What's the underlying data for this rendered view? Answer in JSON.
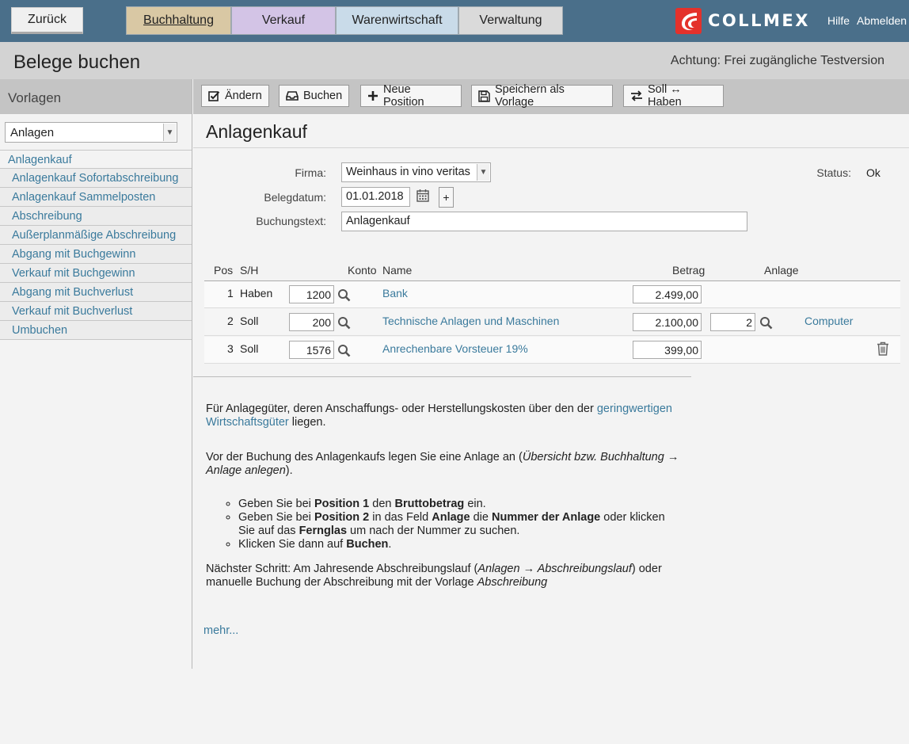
{
  "nav": {
    "back": "Zurück",
    "tabs": [
      "Buchhaltung",
      "Verkauf",
      "Warenwirtschaft",
      "Verwaltung"
    ],
    "logo": "COLLMEX",
    "help": "Hilfe",
    "logout": "Abmelden"
  },
  "header": {
    "title": "Belege buchen",
    "warning": "Achtung: Frei zugängliche Testversion"
  },
  "sidebar": {
    "heading": "Vorlagen",
    "category_selected": "Anlagen",
    "items": [
      "Anlagenkauf",
      "Anlagenkauf Sofortabschreibung",
      "Anlagenkauf Sammelposten",
      "Abschreibung",
      "Außerplanmäßige Abschreibung",
      "Abgang mit Buchgewinn",
      "Verkauf mit Buchgewinn",
      "Abgang mit Buchverlust",
      "Verkauf mit Buchverlust",
      "Umbuchen"
    ]
  },
  "toolbar": {
    "edit": "Ändern",
    "post": "Buchen",
    "new_position": "Neue Position",
    "save_template": "Speichern als Vorlage",
    "swap": "Soll ↔ Haben"
  },
  "form": {
    "title": "Anlagenkauf",
    "firma_label": "Firma:",
    "firma_value": "Weinhaus in vino veritas",
    "belegdatum_label": "Belegdatum:",
    "belegdatum_value": "01.01.2018",
    "plus": "+",
    "buchungstext_label": "Buchungstext:",
    "buchungstext_value": "Anlagenkauf",
    "status_label": "Status:",
    "status_value": "Ok"
  },
  "table": {
    "headers": {
      "pos": "Pos",
      "sh": "S/H",
      "konto": "Konto",
      "name": "Name",
      "betrag": "Betrag",
      "anlage": "Anlage"
    },
    "rows": [
      {
        "pos": "1",
        "sh": "Haben",
        "konto": "1200",
        "name": "Bank",
        "betrag": "2.499,00",
        "anlage": "",
        "anlage_name": ""
      },
      {
        "pos": "2",
        "sh": "Soll",
        "konto": "200",
        "name": "Technische Anlagen und Maschinen",
        "betrag": "2.100,00",
        "anlage": "2",
        "anlage_name": "Computer"
      },
      {
        "pos": "3",
        "sh": "Soll",
        "konto": "1576",
        "name": "Anrechenbare Vorsteuer 19%",
        "betrag": "399,00",
        "anlage": "",
        "anlage_name": ""
      }
    ]
  },
  "help": {
    "p1_a": "Für Anlagegüter, deren Anschaffungs- oder Herstellungskosten über den der ",
    "p1_link": "geringwertigen Wirtschaftsgüter",
    "p1_b": " liegen.",
    "p2_a": "Vor der Buchung des Anlagenkaufs legen Sie eine Anlage an (",
    "p2_em": "Übersicht bzw. Buchhaltung → Anlage anlegen",
    "p2_b": ").",
    "li1_a": "Geben Sie bei ",
    "li1_b1": "Position 1",
    "li1_c": " den ",
    "li1_b2": "Bruttobetrag",
    "li1_d": " ein.",
    "li2_a": "Geben Sie bei ",
    "li2_b1": "Position 2",
    "li2_c": " in das Feld ",
    "li2_b2": "Anlage",
    "li2_d": " die ",
    "li2_b3": "Nummer der Anlage",
    "li2_e": " oder klicken Sie auf das ",
    "li2_b4": "Fernglas",
    "li2_f": " um nach der Nummer zu suchen.",
    "li3_a": "Klicken Sie dann auf ",
    "li3_b": "Buchen",
    "li3_c": ".",
    "p3_a": "Nächster Schritt: Am Jahresende Abschreibungslauf (",
    "p3_em1": "Anlagen → Abschreibungslauf",
    "p3_b": ") oder manuelle Buchung der Abschreibung mit der Vorlage ",
    "p3_em2": "Abschreibung",
    "more": "mehr..."
  }
}
